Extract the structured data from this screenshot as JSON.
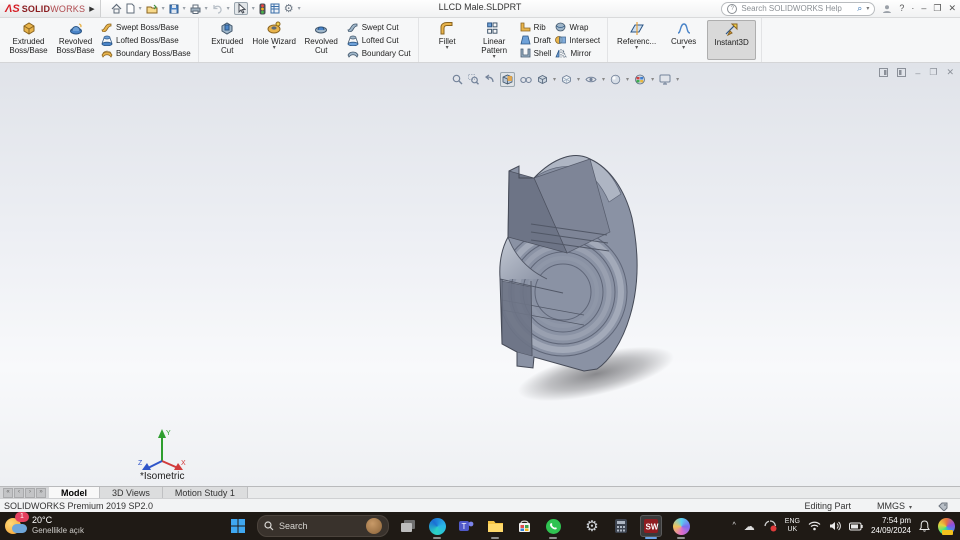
{
  "titlebar": {
    "brand_ds": "ΛS",
    "brand1": "SOLID",
    "brand2": "WORKS",
    "flyout": "▶",
    "title": "LLCD Male.SLDPRT",
    "search_placeholder": "Search SOLIDWORKS Help",
    "search_help_glyph": "?",
    "help": "?",
    "more": "·",
    "minimize": "–",
    "restore": "❐",
    "close": "✕",
    "quick_access_icons": [
      "home-icon",
      "new-file-icon",
      "open-file-icon",
      "save-icon",
      "print-icon",
      "undo-icon",
      "select-cursor-icon",
      "rebuild-icon",
      "file-properties-icon",
      "options-gear-icon"
    ]
  },
  "ribbon": {
    "g1": {
      "b1": {
        "l1": "Extruded",
        "l2": "Boss/Base"
      },
      "b2": {
        "l1": "Revolved",
        "l2": "Boss/Base"
      },
      "s1": "Swept Boss/Base",
      "s2": "Lofted Boss/Base",
      "s3": "Boundary Boss/Base"
    },
    "g2": {
      "b1": {
        "l1": "Extruded",
        "l2": "Cut"
      },
      "b2": {
        "l1": "Hole Wizard",
        "l2": ""
      },
      "b3": {
        "l1": "Revolved",
        "l2": "Cut"
      },
      "s1": "Swept Cut",
      "s2": "Lofted Cut",
      "s3": "Boundary Cut"
    },
    "g3": {
      "b1": {
        "l1": "Fillet",
        "l2": ""
      },
      "b2": {
        "l1": "Linear Pattern",
        "l2": ""
      },
      "s1": "Rib",
      "s2": "Draft",
      "s3": "Shell",
      "s4": "Wrap",
      "s5": "Intersect",
      "s6": "Mirror"
    },
    "g4": {
      "b1": {
        "l1": "Referenc...",
        "l2": ""
      },
      "b2": {
        "l1": "Curves",
        "l2": ""
      },
      "b3": {
        "l1": "Instant3D",
        "l2": ""
      }
    },
    "caret": "▾"
  },
  "viewport": {
    "view_label": "*Isometric",
    "headsup_icons": [
      "zoom-fit-icon",
      "zoom-area-icon",
      "previous-view-icon",
      "section-view-icon",
      "dynamic-annotation-icon",
      "view-orientation-icon",
      "display-style-icon",
      "hide-show-items-icon",
      "edit-appearance-icon",
      "apply-scene-icon",
      "view-settings-icon"
    ],
    "doc_window_controls": [
      "feature-pane-icon",
      "task-pane-icon",
      "minimize",
      "restore",
      "close"
    ],
    "triad": {
      "x": "X",
      "y": "Y",
      "z": "Z"
    },
    "model_name": "LLCD Male part (gray isometric solid)"
  },
  "tabs": {
    "model": "Model",
    "views3d": "3D Views",
    "motion": "Motion Study 1"
  },
  "status": {
    "product": "SOLIDWORKS Premium 2019 SP2.0",
    "mode": "Editing Part",
    "units": "MMGS"
  },
  "taskbar": {
    "weather": {
      "badge": "1",
      "temp": "20°C",
      "condition": "Genellikle açık"
    },
    "search_label": "Search",
    "app_icons": [
      "start-icon",
      "task-view-icon",
      "edge-icon",
      "teams-icon",
      "file-explorer-icon",
      "store-icon",
      "whatsapp-icon",
      "settings-icon",
      "calculator-icon",
      "solidworks-icon",
      "copilot-icon"
    ],
    "tray": {
      "chevron": "^",
      "lang1": "ENG",
      "lang2": "UK",
      "time": "7:54 pm",
      "date": "24/09/2024",
      "tray_icons": [
        "tray-chevron-icon",
        "onedrive-cloud-icon",
        "screen-record-icon",
        "wifi-icon",
        "speaker-icon",
        "battery-icon",
        "notification-bell-icon",
        "widgets-icon"
      ]
    }
  },
  "colors": {
    "accent_red": "#d61f26",
    "taskbar_bg": "#1f1a15",
    "model_gray": "#8a92a4",
    "viewport_top": "#e0e3e9"
  }
}
